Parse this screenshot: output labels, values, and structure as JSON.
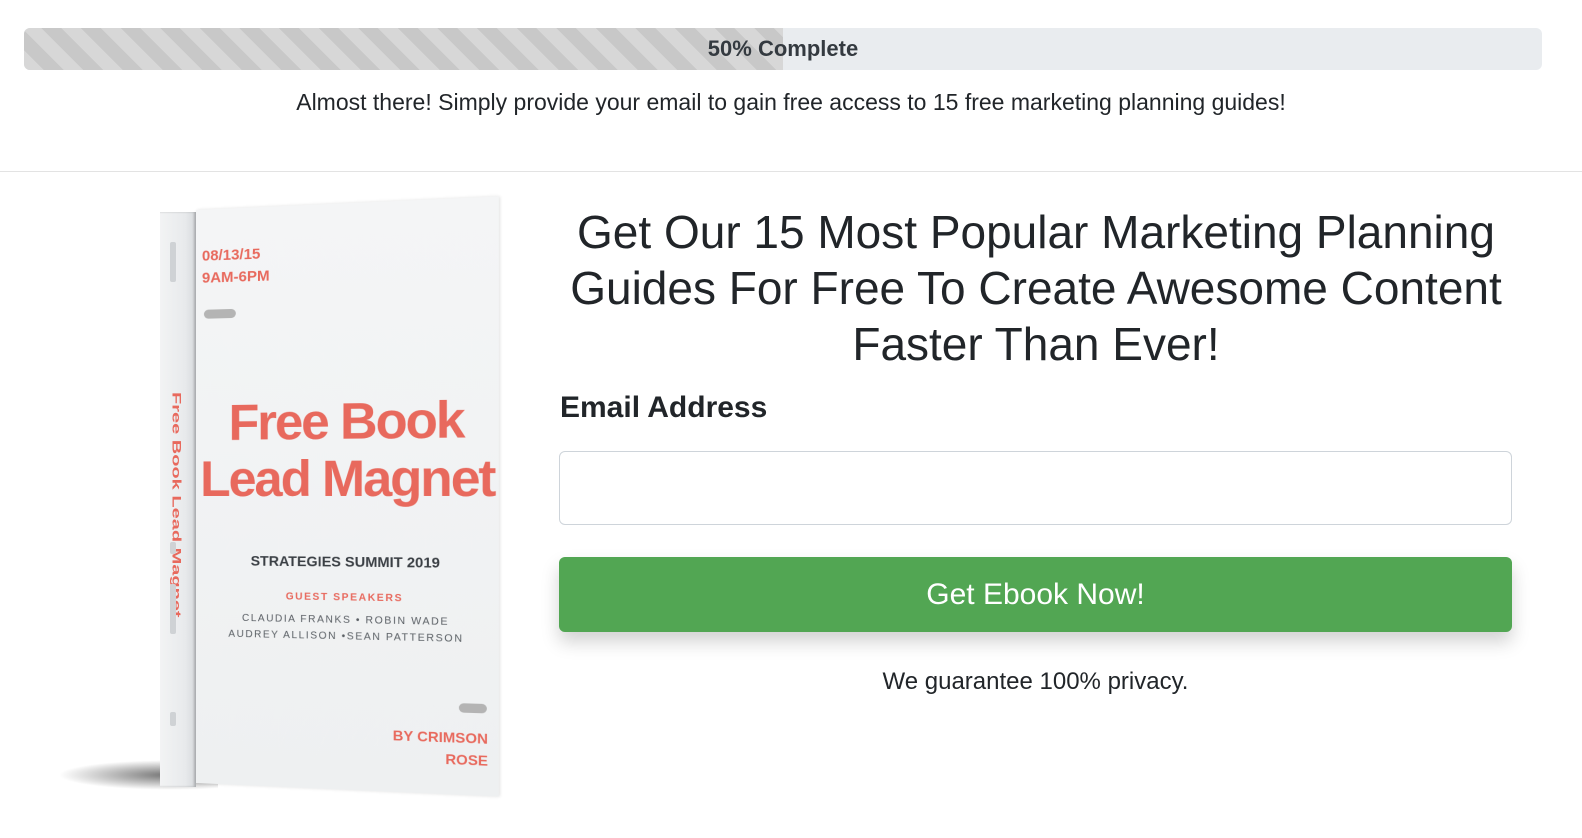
{
  "progress": {
    "label": "50% Complete",
    "percent": 50
  },
  "notice": "Almost there! Simply provide your email to gain free access to 15 free marketing planning guides!",
  "book": {
    "date": "08/13/15",
    "time": "9AM-6PM",
    "title_line1": "Free Book",
    "title_line2": "Lead Magnet",
    "spine_title": "Free Book Lead Magnet",
    "event": "STRATEGIES SUMMIT 2019",
    "speakers_label": "GUEST SPEAKERS",
    "speakers_line1": "CLAUDIA FRANKS • ROBIN WADE",
    "speakers_line2": "AUDREY ALLISON •SEAN PATTERSON",
    "author_line1": "BY CRIMSON",
    "author_line2": "ROSE"
  },
  "headline": "Get Our 15 Most Popular Marketing Planning Guides For Free To Create Awesome Content Faster Than Ever!",
  "form": {
    "email_label": "Email Address",
    "email_value": "",
    "submit_label": "Get Ebook Now!",
    "privacy": "We guarantee 100% privacy."
  },
  "colors": {
    "button": "#52a653",
    "cover_accent": "#e8695d",
    "progress_track": "#e9ecef",
    "progress_fill": "#c8c8c8"
  }
}
